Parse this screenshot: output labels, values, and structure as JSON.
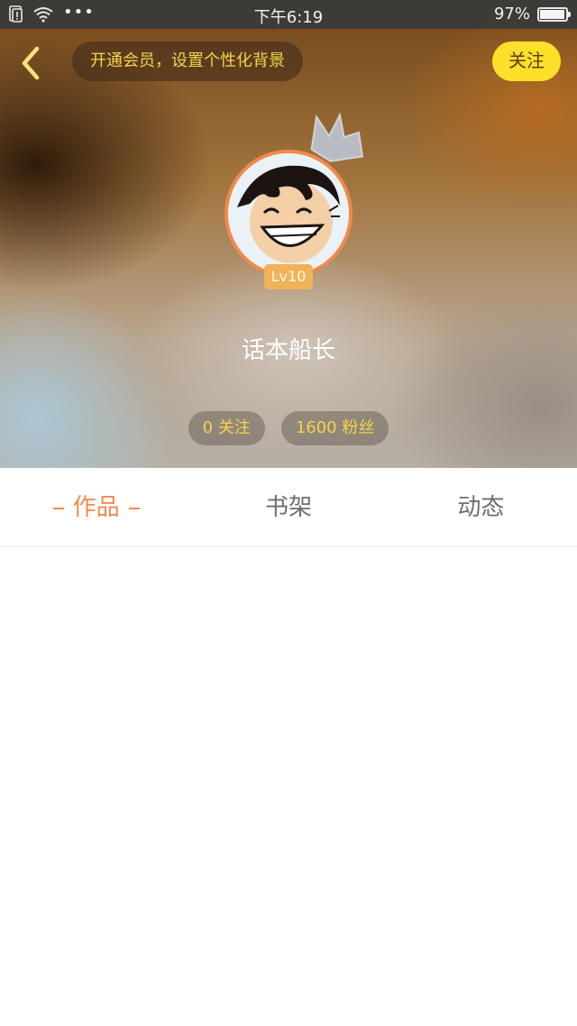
{
  "status_bar": {
    "time": "下午6:19",
    "battery_percent": "97%",
    "battery_level": 0.97,
    "icons": [
      "sim-alert-icon",
      "wifi-icon",
      "more-dots-icon",
      "battery-icon"
    ]
  },
  "header": {
    "back_icon": "chevron-left-icon",
    "vip_banner_text": "开通会员，设置个性化背景",
    "follow_label": "关注",
    "accent_yellow": "#fde02a"
  },
  "profile": {
    "level": "Lv10",
    "username": "话本船长",
    "following_label": "0 关注",
    "followers_label": "1600 粉丝",
    "crown_icon": "crown-icon"
  },
  "tabs": [
    {
      "label": "作品",
      "active": true
    },
    {
      "label": "书架",
      "active": false
    },
    {
      "label": "动态",
      "active": false
    }
  ],
  "colors": {
    "active_tab": "#ef8a4e",
    "inactive_tab": "#6e6e6e",
    "stat_text": "#f5d34a"
  }
}
